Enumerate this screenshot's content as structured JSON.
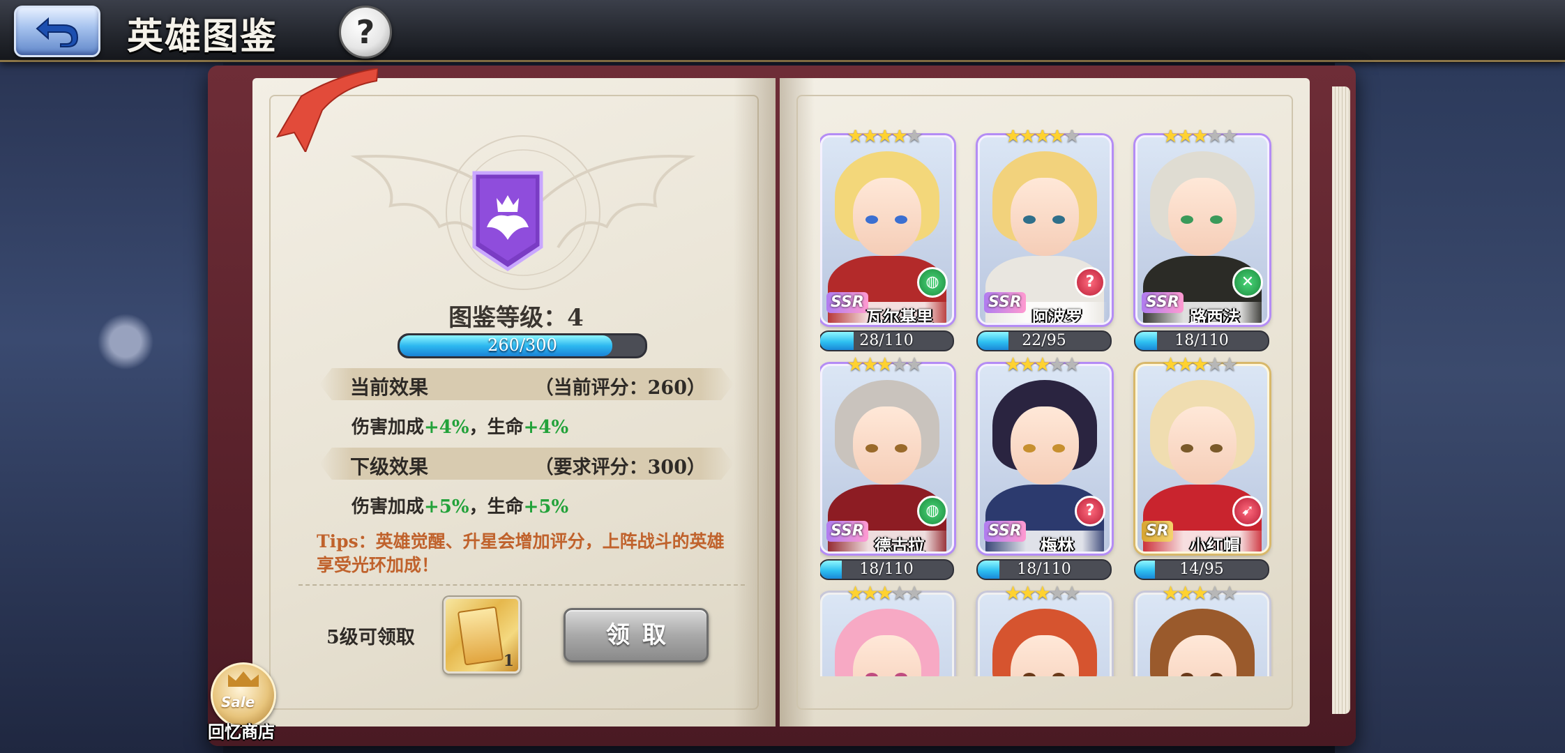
{
  "header": {
    "title": "英雄图鉴",
    "back_icon": "back-arrow-icon",
    "help_label": "?"
  },
  "collection": {
    "level_label": "图鉴等级：4",
    "xp_text": "260/300",
    "xp_current": 260,
    "xp_max": 300
  },
  "current_effect": {
    "title": "当前效果",
    "score_text": "（当前评分：260）",
    "line_prefix": "伤害加成",
    "damage_bonus": "+4%",
    "separator": "，生命",
    "hp_bonus": "+4%"
  },
  "next_effect": {
    "title": "下级效果",
    "score_text": "（要求评分：300）",
    "line_prefix": "伤害加成",
    "damage_bonus": "+5%",
    "separator": "，生命",
    "hp_bonus": "+5%"
  },
  "tips": "Tips：英雄觉醒、升星会增加评分，上阵战斗的英雄享受光环加成！",
  "reward": {
    "label": "5级可领取",
    "item_quantity": "1",
    "claim_button": "领取"
  },
  "shop": {
    "badge": "Sale",
    "label": "回忆商店"
  },
  "colors": {
    "accent_blue": "#2db8f0",
    "bonus_green": "#22a23a",
    "tips_orange": "#c0622c",
    "book_cover": "#6e2d37"
  },
  "heroes": [
    {
      "name": "瓦尔基里",
      "rarity": "SSR",
      "stars": 4,
      "class_icon": "shield-icon",
      "progress_text": "28/110",
      "current": 28,
      "max": 110
    },
    {
      "name": "阿波罗",
      "rarity": "SSR",
      "stars": 4,
      "class_icon": "question-class-icon",
      "progress_text": "22/95",
      "current": 22,
      "max": 95
    },
    {
      "name": "路西法",
      "rarity": "SSR",
      "stars": 3,
      "class_icon": "crossed-swords-icon",
      "progress_text": "18/110",
      "current": 18,
      "max": 110
    },
    {
      "name": "德古拉",
      "rarity": "SSR",
      "stars": 3,
      "class_icon": "shield-icon",
      "progress_text": "18/110",
      "current": 18,
      "max": 110
    },
    {
      "name": "梅林",
      "rarity": "SSR",
      "stars": 3,
      "class_icon": "question-class-icon",
      "progress_text": "18/110",
      "current": 18,
      "max": 110
    },
    {
      "name": "小红帽",
      "rarity": "SR",
      "stars": 3,
      "class_icon": "bow-icon",
      "progress_text": "14/95",
      "current": 14,
      "max": 95
    },
    {
      "name": "",
      "rarity": "",
      "stars": 3,
      "class_icon": "",
      "progress_text": "",
      "current": 0,
      "max": 0
    },
    {
      "name": "",
      "rarity": "",
      "stars": 3,
      "class_icon": "",
      "progress_text": "",
      "current": 0,
      "max": 0
    },
    {
      "name": "",
      "rarity": "",
      "stars": 3,
      "class_icon": "",
      "progress_text": "",
      "current": 0,
      "max": 0
    }
  ]
}
